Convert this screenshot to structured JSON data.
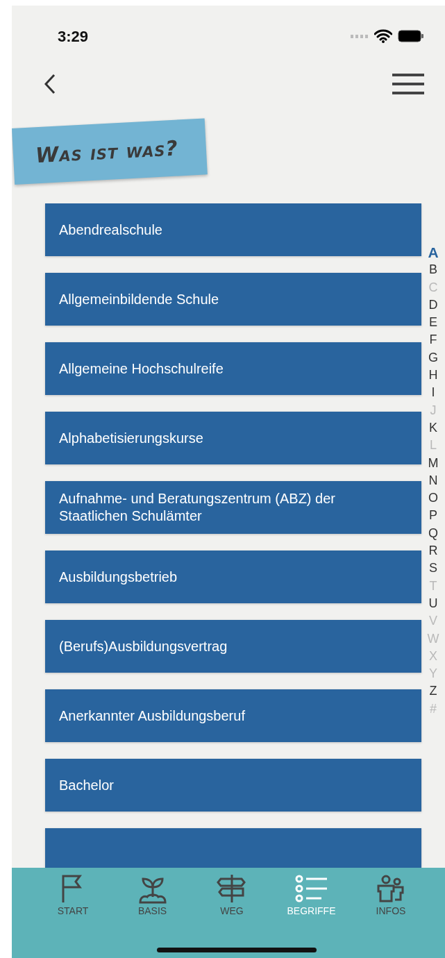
{
  "status_bar": {
    "time": "3:29"
  },
  "title": "Was ist was?",
  "terms": [
    {
      "label": "Abendrealschule"
    },
    {
      "label": "Allgemeinbildende Schule"
    },
    {
      "label": "Allgemeine Hochschulreife"
    },
    {
      "label": "Alphabetisierungskurse"
    },
    {
      "label": "Aufnahme- und Beratungszentrum (ABZ) der Staatlichen Schulämter"
    },
    {
      "label": "Ausbildungsbetrieb"
    },
    {
      "label": "(Berufs)Ausbildungsvertrag"
    },
    {
      "label": "Anerkannter Ausbildungsberuf"
    },
    {
      "label": "Bachelor"
    }
  ],
  "index": [
    {
      "letter": "A",
      "selected": true,
      "disabled": false
    },
    {
      "letter": "B",
      "selected": false,
      "disabled": false
    },
    {
      "letter": "C",
      "selected": false,
      "disabled": true
    },
    {
      "letter": "D",
      "selected": false,
      "disabled": false
    },
    {
      "letter": "E",
      "selected": false,
      "disabled": false
    },
    {
      "letter": "F",
      "selected": false,
      "disabled": false
    },
    {
      "letter": "G",
      "selected": false,
      "disabled": false
    },
    {
      "letter": "H",
      "selected": false,
      "disabled": false
    },
    {
      "letter": "I",
      "selected": false,
      "disabled": false
    },
    {
      "letter": "J",
      "selected": false,
      "disabled": true
    },
    {
      "letter": "K",
      "selected": false,
      "disabled": false
    },
    {
      "letter": "L",
      "selected": false,
      "disabled": true
    },
    {
      "letter": "M",
      "selected": false,
      "disabled": false
    },
    {
      "letter": "N",
      "selected": false,
      "disabled": false
    },
    {
      "letter": "O",
      "selected": false,
      "disabled": false
    },
    {
      "letter": "P",
      "selected": false,
      "disabled": false
    },
    {
      "letter": "Q",
      "selected": false,
      "disabled": false
    },
    {
      "letter": "R",
      "selected": false,
      "disabled": false
    },
    {
      "letter": "S",
      "selected": false,
      "disabled": false
    },
    {
      "letter": "T",
      "selected": false,
      "disabled": true
    },
    {
      "letter": "U",
      "selected": false,
      "disabled": false
    },
    {
      "letter": "V",
      "selected": false,
      "disabled": true
    },
    {
      "letter": "W",
      "selected": false,
      "disabled": true
    },
    {
      "letter": "X",
      "selected": false,
      "disabled": true
    },
    {
      "letter": "Y",
      "selected": false,
      "disabled": true
    },
    {
      "letter": "Z",
      "selected": false,
      "disabled": false
    },
    {
      "letter": "#",
      "selected": false,
      "disabled": true
    }
  ],
  "tabs": [
    {
      "label": "START",
      "kind": "flag",
      "selected": false
    },
    {
      "label": "BASIS",
      "kind": "sprout",
      "selected": false
    },
    {
      "label": "WEG",
      "kind": "signpost",
      "selected": false
    },
    {
      "label": "BEGRIFFE",
      "kind": "list",
      "selected": true
    },
    {
      "label": "INFOS",
      "kind": "people",
      "selected": false
    }
  ]
}
